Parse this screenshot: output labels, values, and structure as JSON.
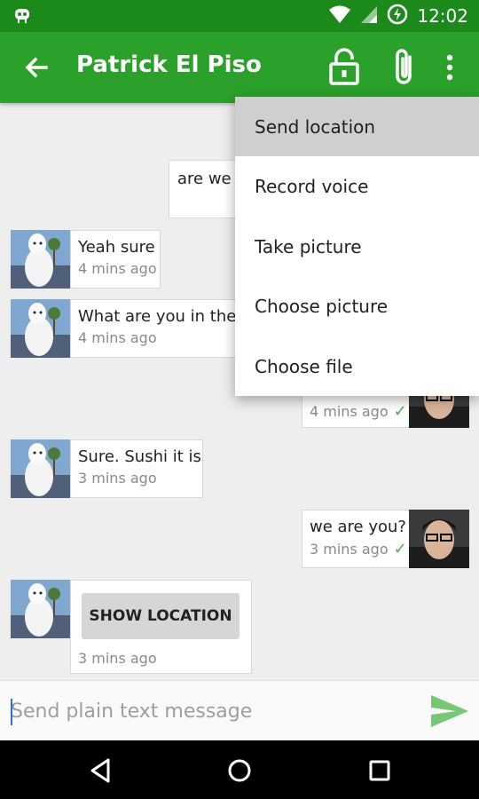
{
  "status_bar": {
    "time": "12:02"
  },
  "app_bar": {
    "title": "Patrick El Piso"
  },
  "colors": {
    "primary": "#2ba12b",
    "primary_dark": "#1b8a1b",
    "send_icon": "#76c776",
    "check": "#4caf50"
  },
  "messages": [
    {
      "side": "out",
      "text": "are we s",
      "time": ""
    },
    {
      "side": "in",
      "text": "Yeah sure",
      "time": "4 mins ago"
    },
    {
      "side": "in",
      "text": "What are you in the m",
      "time": "4 mins ago"
    },
    {
      "side": "out",
      "text": "",
      "time": "4 mins ago"
    },
    {
      "side": "in",
      "text": "Sure. Sushi it is",
      "time": "3 mins ago"
    },
    {
      "side": "out",
      "text": "we are you?",
      "time": "3 mins ago"
    },
    {
      "side": "in",
      "button": "SHOW LOCATION",
      "time": "3 mins ago"
    }
  ],
  "composer": {
    "placeholder": "Send plain text message"
  },
  "overflow_menu": [
    "Send location",
    "Record voice",
    "Take picture",
    "Choose picture",
    "Choose file"
  ],
  "icons": [
    "alien-icon",
    "wifi-icon",
    "signal-icon",
    "battery-charging-icon",
    "back-arrow-icon",
    "lock-icon",
    "attach-icon",
    "more-vert-icon",
    "send-icon",
    "nav-back-icon",
    "nav-home-icon",
    "nav-recents-icon",
    "check-icon"
  ]
}
